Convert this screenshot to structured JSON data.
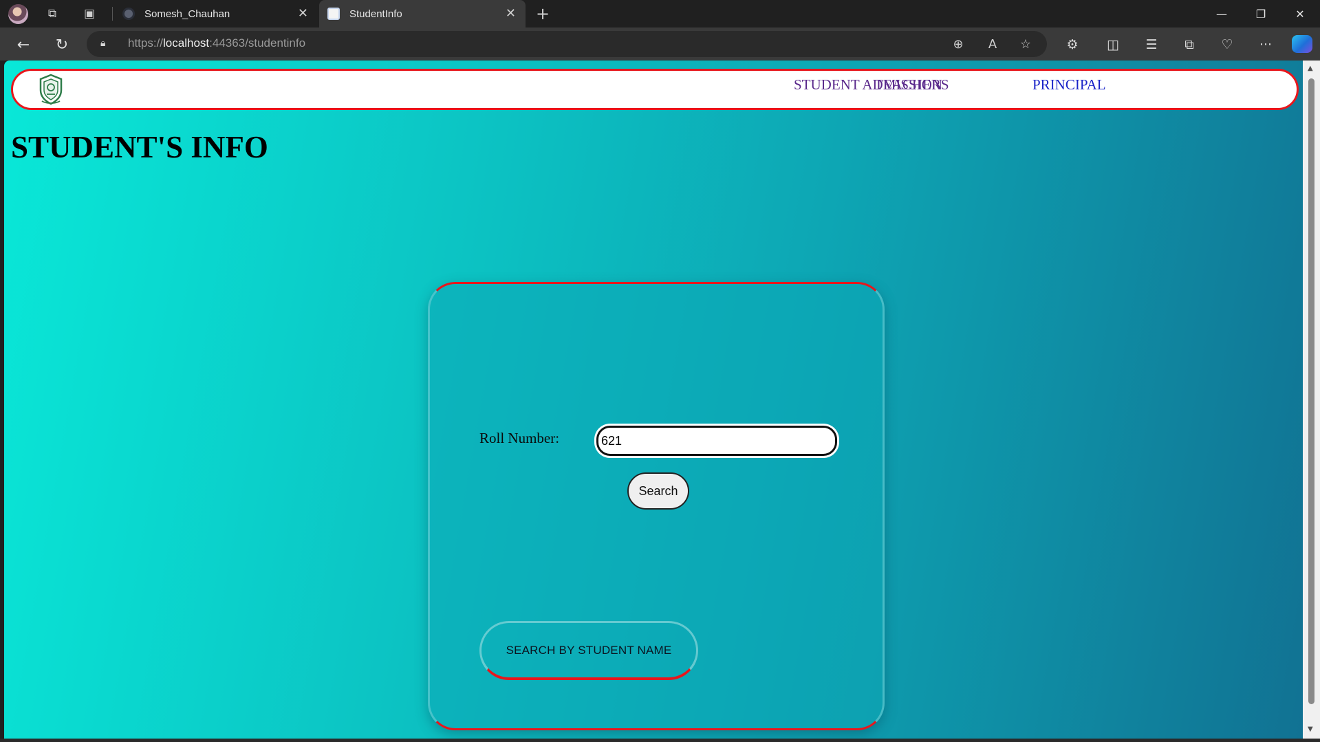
{
  "browser": {
    "tabs": [
      {
        "title": "Somesh_Chauhan",
        "active": false
      },
      {
        "title": "StudentInfo",
        "active": true
      }
    ],
    "url": {
      "scheme": "https://",
      "host": "localhost",
      "rest": ":44363/studentinfo"
    }
  },
  "site": {
    "nav": {
      "admission": "STUDENT ADMISSION",
      "teachers": "TEACHERS",
      "principal": "PRINCIPAL"
    },
    "title": "STUDENT'S INFO",
    "form": {
      "roll_label": "Roll Number:",
      "roll_value": "621",
      "search_label": "Search",
      "by_name_label": "SEARCH BY STUDENT NAME"
    }
  },
  "colors": {
    "accent_red": "#e8161c",
    "bg_start": "#09e8d8",
    "bg_end": "#117293",
    "nav_link": "#5b2a8c",
    "nav_link_principal": "#1a24c8"
  }
}
